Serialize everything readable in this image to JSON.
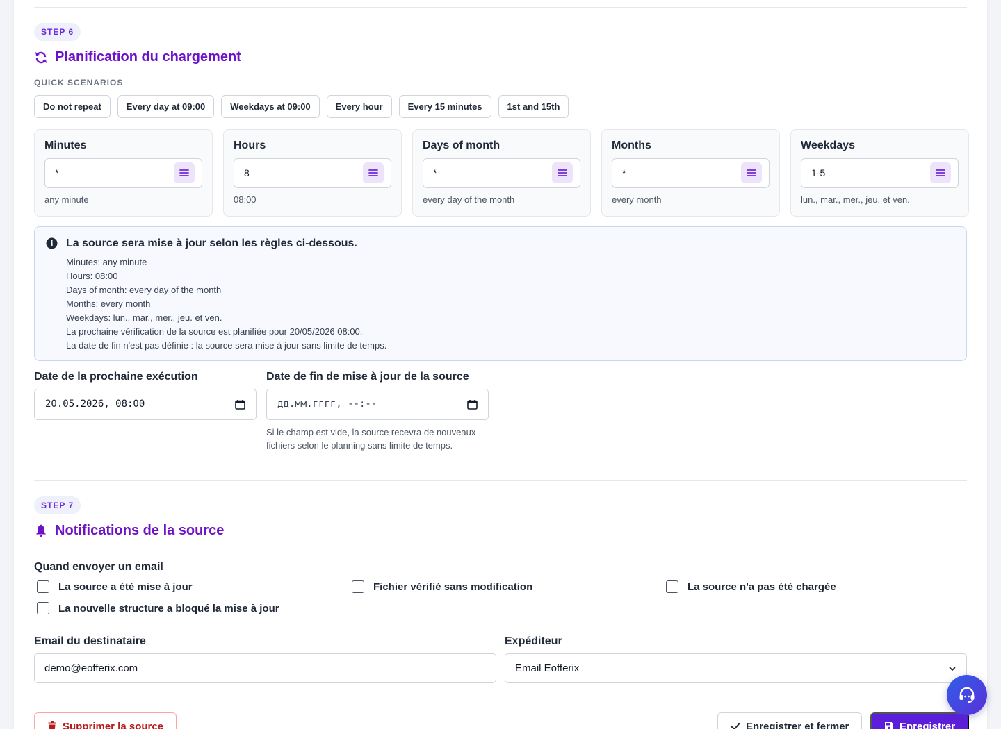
{
  "step6": {
    "badge": "STEP 6",
    "title": "Planification du chargement",
    "quick_scenarios_label": "QUICK SCENARIOS",
    "quick_scenarios": [
      "Do not repeat",
      "Every day at 09:00",
      "Weekdays at 09:00",
      "Every hour",
      "Every 15 minutes",
      "1st and 15th"
    ],
    "cron": [
      {
        "title": "Minutes",
        "value": "*",
        "desc": "any minute"
      },
      {
        "title": "Hours",
        "value": "8",
        "desc": "08:00"
      },
      {
        "title": "Days of month",
        "value": "*",
        "desc": "every day of the month"
      },
      {
        "title": "Months",
        "value": "*",
        "desc": "every month"
      },
      {
        "title": "Weekdays",
        "value": "1-5",
        "desc": "lun., mar., mer., jeu. et ven."
      }
    ],
    "info": {
      "title": "La source sera mise à jour selon les règles ci-dessous.",
      "lines": [
        "Minutes: any minute",
        "Hours: 08:00",
        "Days of month: every day of the month",
        "Months: every month",
        "Weekdays: lun., mar., mer., jeu. et ven.",
        "La prochaine vérification de la source est planifiée pour 20/05/2026 08:00.",
        "La date de fin n'est pas définie : la source sera mise à jour sans limite de temps."
      ]
    },
    "next_run": {
      "label": "Date de la prochaine exécution",
      "value": "20.05.2026, 08:00"
    },
    "end_date": {
      "label": "Date de fin de mise à jour de la source",
      "placeholder": "дд.мм.гггг, --:--",
      "help_line1": "Si le champ est vide, la source recevra de nouveaux",
      "help_line2": "fichiers selon le planning sans limite de temps."
    }
  },
  "step7": {
    "badge": "STEP 7",
    "title": "Notifications de la source",
    "when_label": "Quand envoyer un email",
    "checkboxes": [
      {
        "label": "La source a été mise à jour",
        "checked": false
      },
      {
        "label": "Fichier vérifié sans modification",
        "checked": false
      },
      {
        "label": "La source n'a pas été chargée",
        "checked": false
      },
      {
        "label": "La nouvelle structure a bloqué la mise à jour",
        "checked": false
      }
    ],
    "recipient": {
      "label": "Email du destinataire",
      "value": "demo@eofferix.com"
    },
    "sender": {
      "label": "Expéditeur",
      "value": "Email Eofferix"
    }
  },
  "actions": {
    "delete": "Supprimer la source",
    "save_close": "Enregistrer et fermer",
    "save": "Enregistrer"
  },
  "icons": {
    "schedule": "refresh-icon",
    "notifications": "bell-icon",
    "info": "info-circle-icon",
    "cron_menu": "list-icon",
    "calendar": "calendar-icon",
    "chevron": "chevron-down-icon",
    "delete": "trash-icon",
    "save_close": "check-icon",
    "save": "floppy-disk-icon",
    "support": "headset-icon"
  },
  "colors": {
    "accent": "#6d12c9",
    "primary_button": "#5b1fd9",
    "danger": "#b91c1c",
    "info_border": "#c7d7f2"
  }
}
